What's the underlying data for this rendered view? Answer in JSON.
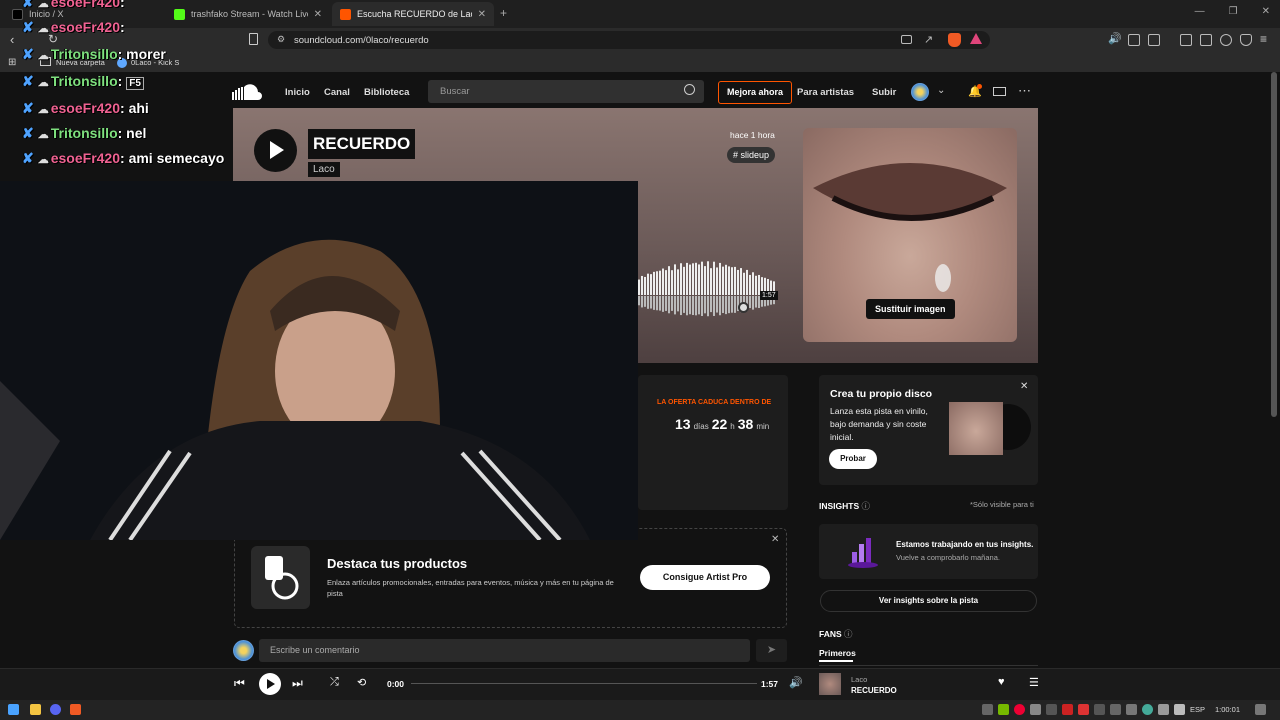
{
  "browser": {
    "tabs": [
      {
        "label": "Inicio / X",
        "color": "#000000"
      },
      {
        "label": "trashfako Stream - Watch Live on Kick",
        "color": "#53fc18"
      },
      {
        "label": "Escucha RECUERDO de Laco | Descubre",
        "color": "#ff5500"
      }
    ],
    "url": "soundcloud.com/0laco/recuerdo",
    "bookmarks": [
      "Nueva carpeta",
      "0Laco - Kick S"
    ]
  },
  "chat": [
    {
      "user": "esoeFr420",
      "text": ":"
    },
    {
      "user": "esoeFr420",
      "text": ":"
    },
    {
      "user": "Tritonsillo",
      "text": ": morer"
    },
    {
      "user": "Tritonsillo",
      "text": ":"
    },
    {
      "user": "esoeFr420",
      "text": ": ahi"
    },
    {
      "user": "Tritonsillo",
      "text": ": nel"
    },
    {
      "user": "esoeFr420",
      "text": ": ami semecayo"
    }
  ],
  "chat_extra": {
    "badge": "F5"
  },
  "nav": {
    "inicio": "Inicio",
    "canal": "Canal",
    "biblioteca": "Biblioteca",
    "search_placeholder": "Buscar",
    "mejora": "Mejora ahora",
    "artistas": "Para artistas",
    "subir": "Subir"
  },
  "track": {
    "title": "RECUERDO",
    "artist": "Laco",
    "posted": "hace 1 hora",
    "tag": "# slideup",
    "duration": "1:57",
    "replace_image": "Sustituir imagen"
  },
  "offer": {
    "label": "LA OFERTA CADUCA DENTRO DE",
    "days": "13",
    "days_unit": "días",
    "hours": "22",
    "hours_unit": "h",
    "mins": "38",
    "mins_unit": "min"
  },
  "promo": {
    "title": "Destaca tus productos",
    "desc": "Enlaza artículos promocionales, entradas para eventos, música y más en tu página de pista",
    "button": "Consigue Artist Pro"
  },
  "comment": {
    "placeholder": "Escribe un comentario"
  },
  "disco": {
    "title": "Crea tu propio disco",
    "desc": "Lanza esta pista en vinilo, bajo demanda y sin coste inicial.",
    "button": "Probar"
  },
  "insights": {
    "heading": "INSIGHTS",
    "note": "*Sólo visible para ti",
    "line1": "Estamos trabajando en tus insights.",
    "line2": "Vuelve a comprobarlo mañana.",
    "button": "Ver insights sobre la pista"
  },
  "fans": {
    "heading": "FANS",
    "tab": "Primeros"
  },
  "player": {
    "time": "0:00",
    "duration": "1:57",
    "artist": "Laco",
    "title": "RECUERDO",
    "progress": 0
  },
  "taskbar": {
    "lang": "ESP",
    "time": "1:00:01"
  },
  "colors": {
    "accent": "#ff5500",
    "chat_user_a": "#f06292",
    "chat_user_b": "#7ee07e"
  }
}
